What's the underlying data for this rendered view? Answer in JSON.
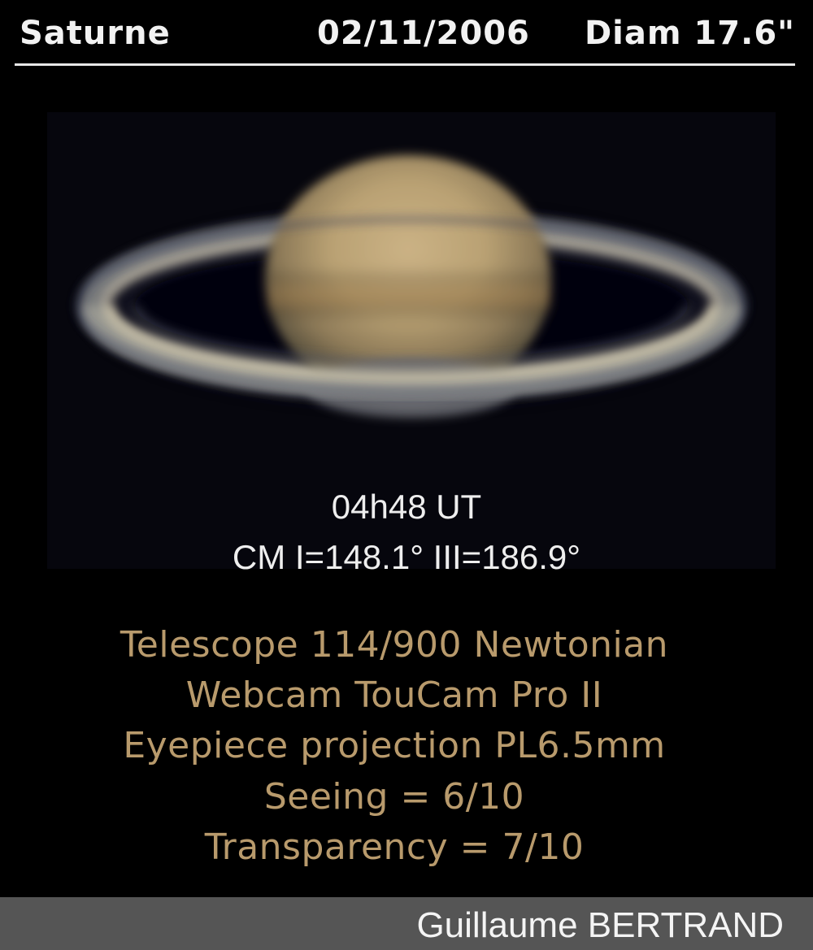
{
  "header": {
    "object": "Saturne",
    "date": "02/11/2006",
    "diameter": "Diam 17.6\""
  },
  "observation": {
    "time": "04h48 UT",
    "central_meridian": "CM  I=148.1° III=186.9°"
  },
  "setup": {
    "telescope": "Telescope 114/900 Newtonian",
    "camera": "Webcam TouCam Pro II",
    "method": "Eyepiece projection PL6.5mm",
    "seeing": "Seeing = 6/10",
    "transparency": "Transparency = 7/10"
  },
  "credit": {
    "author": "Guillaume BERTRAND"
  },
  "colors": {
    "background": "#000000",
    "setup_text": "#b89a6c",
    "footer_band": "#555555"
  }
}
